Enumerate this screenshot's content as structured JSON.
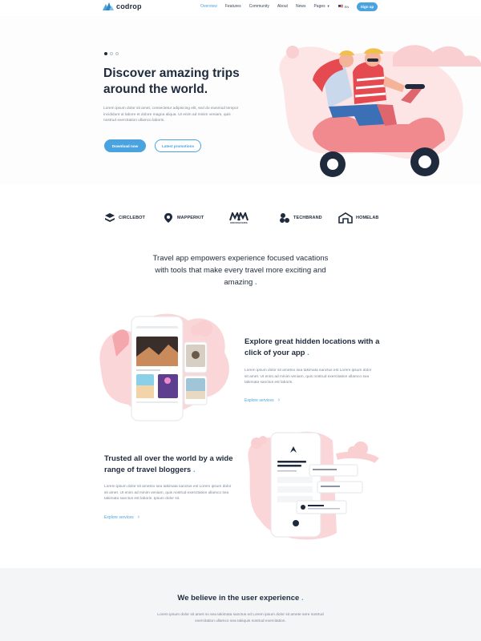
{
  "brand": {
    "name": "codrop",
    "accent": "#4aa3df",
    "pink": "#f7b8bd"
  },
  "nav": {
    "items": [
      {
        "label": "Overview",
        "active": true
      },
      {
        "label": "Features",
        "active": false
      },
      {
        "label": "Community",
        "active": false
      },
      {
        "label": "About",
        "active": false
      },
      {
        "label": "News",
        "active": false
      },
      {
        "label": "Pages",
        "active": false
      }
    ],
    "language": "EN",
    "signup_label": "Sign up"
  },
  "hero": {
    "title": "Discover amazing trips around the world.",
    "body": "Lorem ipsum dolor sit amet, consectetur adipiscing elit, sed do eiusmod tempor incididunt ut labore et dolore magna aliqua. Ut enim ad minim veniam, quis nostrud exercitation ullamco laboris.",
    "primary_button": "Download now",
    "secondary_button": "Latest promotions",
    "slides": 3,
    "active_slide": 1
  },
  "brands": [
    "CIRCLEBOT",
    "MAPPERKIT",
    "MONOGRAMS",
    "TECHBRAND",
    "HOMELAB"
  ],
  "intro": {
    "text": "Travel app empowers experience focused vacations with tools that make every travel more exciting and amazing",
    "accent": "."
  },
  "feature1": {
    "title": "Explore great hidden locations with a click of your app",
    "accent": ".",
    "body": "Lorem ipsum dolor sit ametno sea takimata sanctus est Lorem ipsum dolor sit amet. Ut enim ad minim veniam, quis nostrud exercitation ullamco sea takimata sanctus est laboris.",
    "link": "Explore services"
  },
  "feature2": {
    "title": "Trusted all over the world by a wide range of travel bloggers",
    "accent": ".",
    "body": "Lorem ipsum dolor sit ametno sea takimata sanctus est Lorem ipsum dolor sit amet. Ut enim ad minim veniam, quis nostrud exercitation ullamco sea takimata sanctus est laboris. Ipsum dolor sit.",
    "link": "Explore services"
  },
  "believe": {
    "title": "We believe in the user experience",
    "accent": ".",
    "body": "Lorem ipsum dolor sit amet no sea takimata sanctus ed Lorem ipsum dolor sit amete sere nostrud exercitation ullamco sea takiquis nostrud exercitation."
  }
}
